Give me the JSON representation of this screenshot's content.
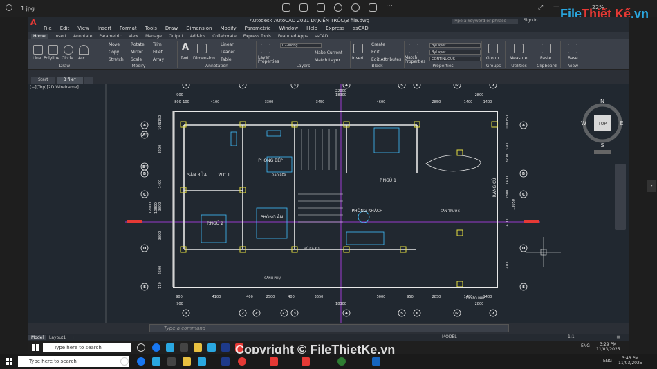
{
  "viewer": {
    "file_name": "1.jpg",
    "zoom": "22%"
  },
  "watermark": {
    "brand_a": "File",
    "brand_b": "Thiết Kế",
    "brand_c": ".vn",
    "copyright": "Copyright © FileThietKe.vn"
  },
  "app": {
    "title": "Autodesk AutoCAD 2021   D:\\KIẾN TRÚC\\B file.dwg",
    "search_placeholder": "Type a keyword or phrase",
    "signin": "Sign In",
    "menu": [
      "File",
      "Edit",
      "View",
      "Insert",
      "Format",
      "Tools",
      "Draw",
      "Dimension",
      "Modify",
      "Parametric",
      "Window",
      "Help",
      "Express",
      "ssCAD"
    ],
    "ribbon_tabs": [
      "Home",
      "Insert",
      "Annotate",
      "Parametric",
      "View",
      "Manage",
      "Output",
      "Add-ins",
      "Collaborate",
      "Express Tools",
      "Featured Apps",
      "ssCAD"
    ],
    "ribbon": {
      "draw": {
        "label": "Draw",
        "items": [
          "Line",
          "Polyline",
          "Circle",
          "Arc"
        ]
      },
      "modify": {
        "label": "Modify",
        "items": [
          "Move",
          "Rotate",
          "Trim",
          "Copy",
          "Mirror",
          "Fillet",
          "Stretch",
          "Scale",
          "Array"
        ]
      },
      "annotation": {
        "label": "Annotation",
        "items": [
          "Text",
          "Dimension",
          "Linear",
          "Leader",
          "Table"
        ]
      },
      "layers": {
        "label": "Layers",
        "layer_name": "02-Tuong",
        "items": [
          "Layer Properties",
          "Make Current",
          "Match Layer"
        ]
      },
      "block": {
        "label": "Block",
        "items": [
          "Insert",
          "Create",
          "Edit",
          "Edit Attributes"
        ]
      },
      "properties": {
        "label": "Properties",
        "items": [
          "Match Properties"
        ],
        "color": "ByLayer",
        "lineweight": "ByLayer",
        "linetype": "CONTINUOUS"
      },
      "groups": {
        "label": "Groups",
        "items": [
          "Group"
        ]
      },
      "utilities": {
        "label": "Utilities",
        "items": [
          "Measure"
        ]
      },
      "clipboard": {
        "label": "Clipboard",
        "items": [
          "Paste"
        ]
      },
      "view": {
        "label": "View",
        "items": [
          "Base"
        ]
      }
    },
    "doc_tabs": [
      "Start",
      "B file*"
    ],
    "view_label": "[−][Top][2D Wireframe]",
    "viewcube": {
      "top": "TOP",
      "n": "N",
      "s": "S",
      "e": "E",
      "w": "W"
    },
    "command_placeholder": "Type a command",
    "layout_tabs": [
      "Model",
      "Layout1"
    ],
    "status_model": "MODEL",
    "status_scale": "1:1"
  },
  "drawing": {
    "grid_top": [
      "1",
      "2",
      "3",
      "4",
      "5",
      "6",
      "6'",
      "7"
    ],
    "grid_bottom": [
      "1",
      "2",
      "2'",
      "2\"",
      "3",
      "4",
      "5",
      "6",
      "6'",
      "7"
    ],
    "grid_left": [
      "A",
      "B",
      "C",
      "D",
      "E"
    ],
    "grid_left_extra": [
      "A'",
      "B'"
    ],
    "dims_top_overall": "22000",
    "dims_top_a": [
      "900",
      "18300",
      "2800"
    ],
    "dims_top_b": [
      "800",
      "100",
      "4100",
      "3300",
      "3450",
      "4600",
      "2850",
      "1400",
      "1400"
    ],
    "dims_bottom_a": [
      "900",
      "4100",
      "400",
      "2500",
      "400",
      "3650",
      "5000",
      "950",
      "2850",
      "1400",
      "1400"
    ],
    "dims_bottom_b": [
      "900",
      "18300",
      "2800"
    ],
    "dims_left": [
      "1150",
      "100",
      "3200",
      "1400",
      "3600",
      "3600",
      "2600",
      "110"
    ],
    "dims_left_total": [
      "12000",
      "10800"
    ],
    "dims_right": [
      "1150",
      "100",
      "3200",
      "3200",
      "1400",
      "2300",
      "4100",
      "2700"
    ],
    "dims_right_total": "13050",
    "rooms": [
      "SÂN RỬA",
      "W.C 1",
      "PHÒNG BẾP",
      "ĐẢO BẾP",
      "P.NGỦ 1",
      "P.NGỦ 2",
      "PHÒNG ĂN",
      "PHÒNG KHÁCH",
      "SÂN TRƯỚC",
      "HỐ CẢ KOI",
      "SÂNH PHỤ",
      "LỐI VÀO PHỤ",
      "RĂNG CỬ"
    ]
  },
  "taskbar_inner": {
    "search": "Type here to search",
    "time": "3:29 PM",
    "date": "11/03/2025",
    "lang": "ENG"
  },
  "taskbar_outer": {
    "search": "Type here to search",
    "time": "3:43 PM",
    "date": "11/03/2025",
    "lang": "ENG"
  },
  "colors": {
    "canvas": "#212830",
    "wall": "#e8e8e8",
    "grid": "#c8c8c8",
    "red_marker": "#e53935",
    "axis_magenta": "#c040ff",
    "yellow": "#e8e040",
    "cyan": "#40c0ff"
  }
}
